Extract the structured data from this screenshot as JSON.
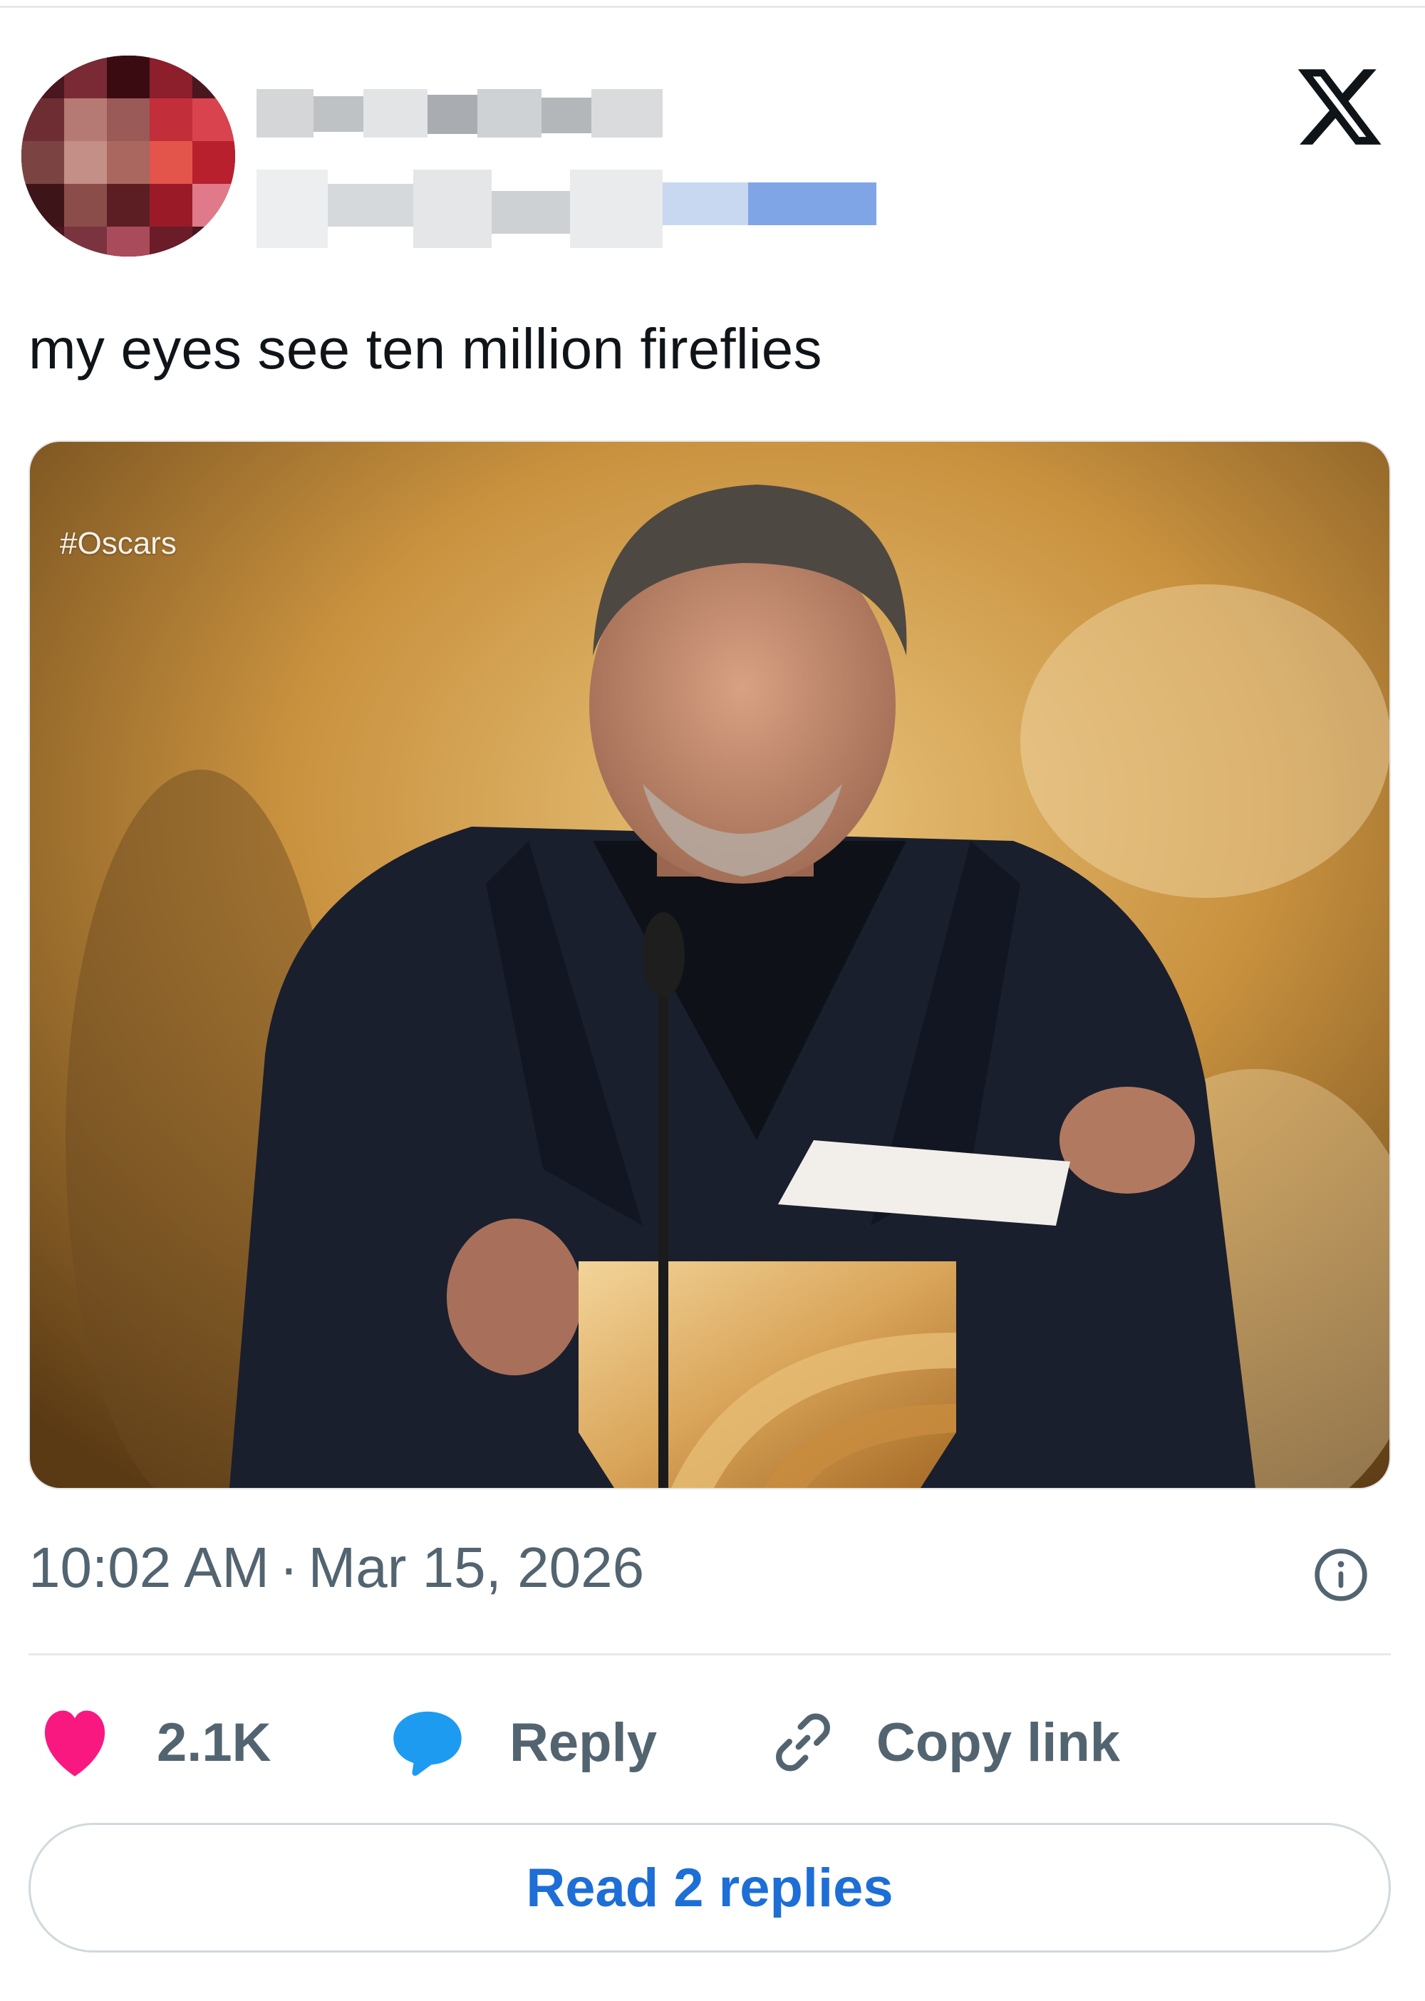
{
  "tweet": {
    "text": "my eyes see ten million fireflies",
    "media_hashtag": "#Oscars",
    "time": "10:02 AM",
    "separator": "·",
    "date": "Mar 15, 2026"
  },
  "actions": {
    "like_count": "2.1K",
    "reply_label": "Reply",
    "copy_link_label": "Copy link",
    "read_replies_label": "Read 2 replies"
  },
  "icons": {
    "brand": "x-logo-icon",
    "info": "info-icon",
    "like": "heart-icon",
    "reply": "speech-bubble-icon",
    "copy": "link-icon"
  },
  "colors": {
    "like": "#f91880",
    "reply": "#1d9bf0",
    "link_text": "#1d6ed6",
    "secondary_text": "#536471"
  }
}
